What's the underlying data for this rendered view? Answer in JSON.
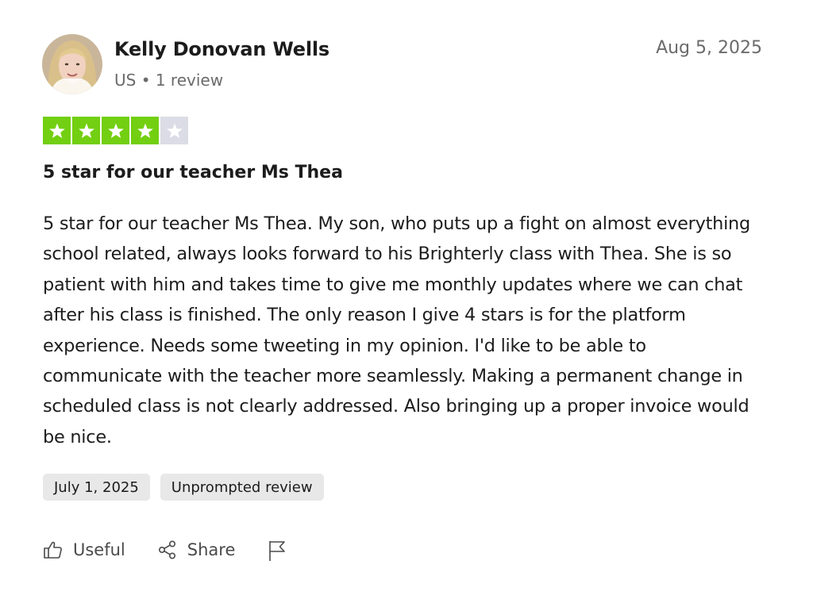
{
  "reviewer": {
    "name": "Kelly Donovan Wells",
    "meta": "US • 1 review"
  },
  "review": {
    "date": "Aug 5, 2025",
    "rating": 4,
    "rating_max": 5,
    "title": "5 star for our teacher Ms Thea",
    "body": "5 star for our teacher Ms Thea. My son, who puts up a fight on almost everything school related, always looks forward to his Brighterly class with Thea. She is so patient with him and takes time to give me monthly updates where we can chat after his class is finished. The only reason I give 4 stars is for the platform experience. Needs some tweeting in my opinion. I'd like to be able to communicate with the teacher more seamlessly. Making a permanent change in scheduled class is not clearly addressed. Also bringing up a proper invoice would be nice.",
    "tags": {
      "experience_date": "July 1, 2025",
      "type": "Unprompted review"
    }
  },
  "actions": {
    "useful_label": "Useful",
    "share_label": "Share"
  },
  "icons": {
    "useful": "thumbs-up-icon",
    "share": "share-icon",
    "flag": "flag-icon",
    "star": "star-icon"
  },
  "colors": {
    "star_filled": "#73cf11",
    "star_empty": "#dcdce6",
    "text_primary": "#1c1c1c",
    "text_secondary": "#6b6b6b",
    "tag_bg": "#e8e8e8"
  }
}
